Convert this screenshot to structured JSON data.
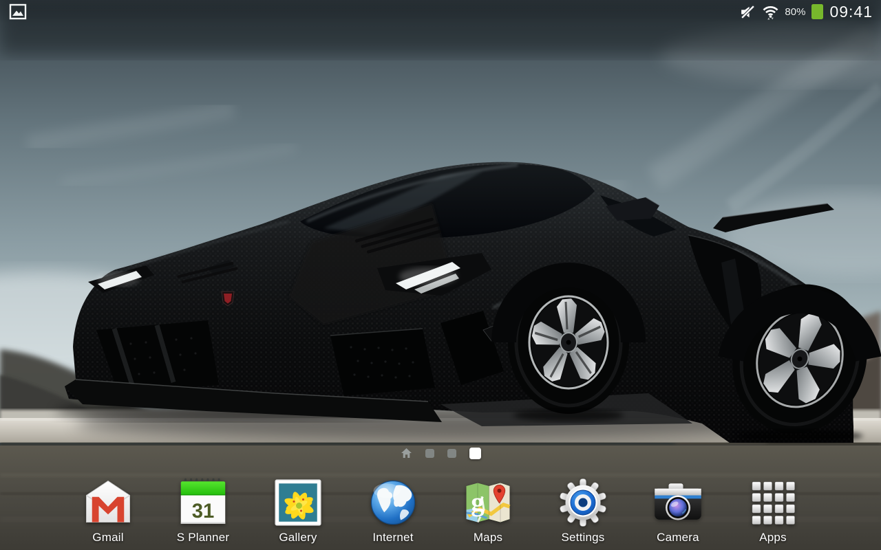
{
  "status_bar": {
    "left_icon": "screenshot-captured-icon",
    "mute_icon": "mute-speaker-icon",
    "wifi_icon": "wifi-signal-icon",
    "battery_percent": "80%",
    "battery_icon": "battery-icon",
    "battery_color": "#77b82c",
    "time": "09:41"
  },
  "page_indicator": {
    "items": [
      {
        "type": "home",
        "icon": "home-icon",
        "active": false
      },
      {
        "type": "page",
        "active": false
      },
      {
        "type": "page",
        "active": false
      },
      {
        "type": "page",
        "active": true
      }
    ]
  },
  "dock": {
    "calendar_day": "31",
    "maps_letter": "g",
    "apps": [
      {
        "label": "Gmail",
        "icon": "gmail-icon"
      },
      {
        "label": "S Planner",
        "icon": "s-planner-icon"
      },
      {
        "label": "Gallery",
        "icon": "gallery-icon"
      },
      {
        "label": "Internet",
        "icon": "internet-icon"
      },
      {
        "label": "Maps",
        "icon": "maps-icon"
      },
      {
        "label": "Settings",
        "icon": "settings-icon"
      },
      {
        "label": "Camera",
        "icon": "camera-icon"
      },
      {
        "label": "Apps",
        "icon": "apps-icon"
      }
    ]
  }
}
